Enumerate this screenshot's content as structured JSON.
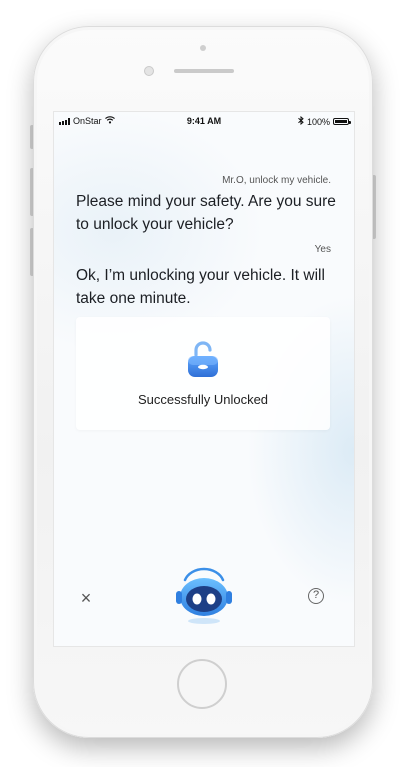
{
  "status_bar": {
    "carrier": "OnStar",
    "time": "9:41 AM",
    "battery": "100%"
  },
  "conversation": {
    "user_message_1": "Mr.O, unlock my vehicle.",
    "assistant_message_1": "Please mind your safety. Are you sure to unlock your vehicle?",
    "user_message_2": "Yes",
    "assistant_message_2": "Ok, I’m unlocking your vehicle. It will take one minute."
  },
  "result_card": {
    "icon": "unlock-icon",
    "label": "Successfully Unlocked"
  },
  "bottom_bar": {
    "close_icon": "close-icon",
    "close_glyph": "×",
    "assistant_icon": "robot-assistant-icon",
    "help_icon": "help-icon",
    "help_glyph": "?"
  },
  "colors": {
    "accent": "#2f7fe0",
    "accent_light": "#5fa8ff",
    "text_primary": "#1c1f24",
    "text_secondary": "#555555"
  }
}
